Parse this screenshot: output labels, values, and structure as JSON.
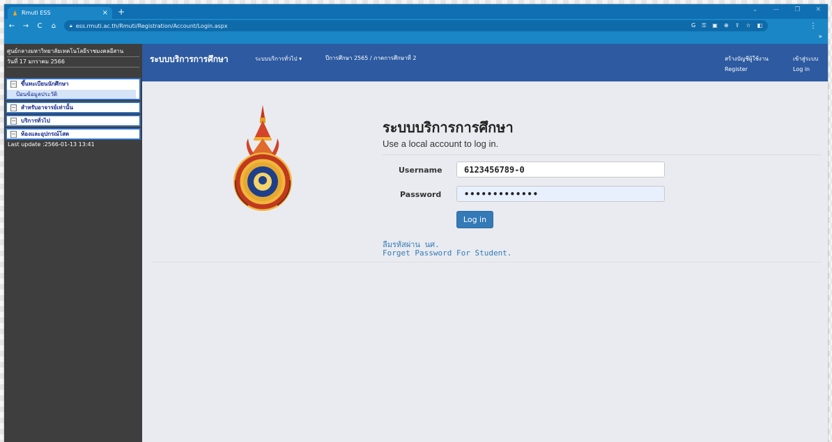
{
  "browser": {
    "tab_title": "Rmuti ESS",
    "tab_close": "×",
    "new_tab": "+",
    "url": "ess.rmuti.ac.th/Rmuti/Registration/Account/Login.aspx"
  },
  "sidebar": {
    "org_name": "ศูนย์กลางมหาวิทยาลัยเทคโนโลยีราชมงคลอีสาน",
    "date": "วันที่ 17 มกราคม 2566",
    "items": [
      {
        "label": "ขึ้นทะเบียนนักศึกษา",
        "sub": "ป้อนข้อมูลประวัติ"
      },
      {
        "label": "สำหรับอาจารย์เท่านั้น"
      },
      {
        "label": "บริการทั่วไป"
      },
      {
        "label": "ห้องและอุปกรณ์โสต"
      }
    ],
    "last_update": "Last update :2566-01-13 13:41"
  },
  "navbar": {
    "brand": "ระบบบริการการศึกษา",
    "general_services": "ระบบบริการทั่วไป ▾",
    "term": "ปีการศึกษา 2565 / ภาคการศึกษาที่ 2",
    "create_account_th": "สร้างบัญชีผู้ใช้งาน",
    "register": "Register",
    "login_th": "เข้าสู่ระบบ",
    "login": "Log in"
  },
  "form": {
    "title": "ระบบบริการการศึกษา",
    "subtitle": "Use a local account to log in.",
    "username_label": "Username",
    "username_value": "6123456789-0",
    "password_label": "Password",
    "password_value": "•••••••••••••",
    "login_button": "Log in",
    "forgot_th": "ลืมรหัสผ่าน นศ.",
    "forgot_en": "Forget Password For Student."
  },
  "colors": {
    "navbar": "#2d5aa0",
    "browser": "#1a86c6",
    "sidebar": "#3e3e3e",
    "button": "#337ab7"
  }
}
